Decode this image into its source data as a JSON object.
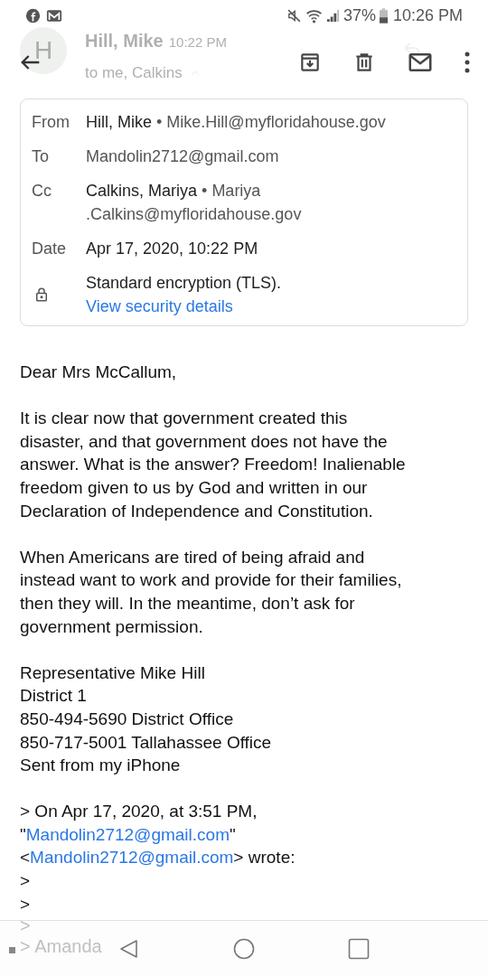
{
  "status_bar": {
    "battery": "37%",
    "time": "10:26 PM"
  },
  "header": {
    "avatar_letter": "H",
    "sender": "Hill, Mike",
    "time": "10:22 PM",
    "recipients": "to me, Calkins"
  },
  "details": {
    "rows": [
      {
        "kind": "person",
        "label": "From",
        "name": "Hill, Mike",
        "separator": "•",
        "address": "Mike.Hill@myfloridahouse.gov"
      },
      {
        "kind": "plain",
        "label": "To",
        "value": "Mandolin2712@gmail.com"
      },
      {
        "kind": "person",
        "label": "Cc",
        "name": "Calkins, Mariya",
        "separator": "•",
        "address": "Mariya .Calkins@myfloridahouse.gov"
      },
      {
        "kind": "dark",
        "label": "Date",
        "value": "Apr 17, 2020, 10:22 PM"
      },
      {
        "kind": "security",
        "value": "Standard encryption (TLS).",
        "link": "View security details"
      }
    ]
  },
  "body": {
    "paragraphs": [
      [
        "Dear Mrs McCallum,"
      ],
      [
        "It is clear now that government created this",
        "disaster, and that government does not have the",
        "answer. What is the answer?  Freedom!  Inalienable",
        "freedom given to us by God and written in our",
        "Declaration of Independence and Constitution."
      ],
      [
        "When Americans are tired of being afraid and",
        "instead want to work and provide for their families,",
        "then they will. In the meantime, don’t ask for",
        "government permission."
      ],
      [
        "Representative Mike Hill",
        "District 1",
        "850-494-5690 District Office",
        "850-717-5001 Tallahassee Office",
        "Sent from my iPhone"
      ]
    ],
    "quote": [
      [
        {
          "kind": "text",
          "text": "> On Apr 17, 2020, at 3:51 PM,"
        }
      ],
      [
        {
          "kind": "text",
          "text": "\""
        },
        {
          "kind": "link",
          "text": "Mandolin2712@gmail.com"
        },
        {
          "kind": "text",
          "text": "\""
        }
      ],
      [
        {
          "kind": "text",
          "text": "<"
        },
        {
          "kind": "link",
          "text": "Mandolin2712@gmail.com"
        },
        {
          "kind": "text",
          "text": "> wrote:"
        }
      ],
      [
        {
          "kind": "text",
          "text": ">"
        }
      ],
      [
        {
          "kind": "text",
          "text": ">"
        }
      ]
    ],
    "faded_quote": [
      ">",
      "> Amanda"
    ]
  }
}
